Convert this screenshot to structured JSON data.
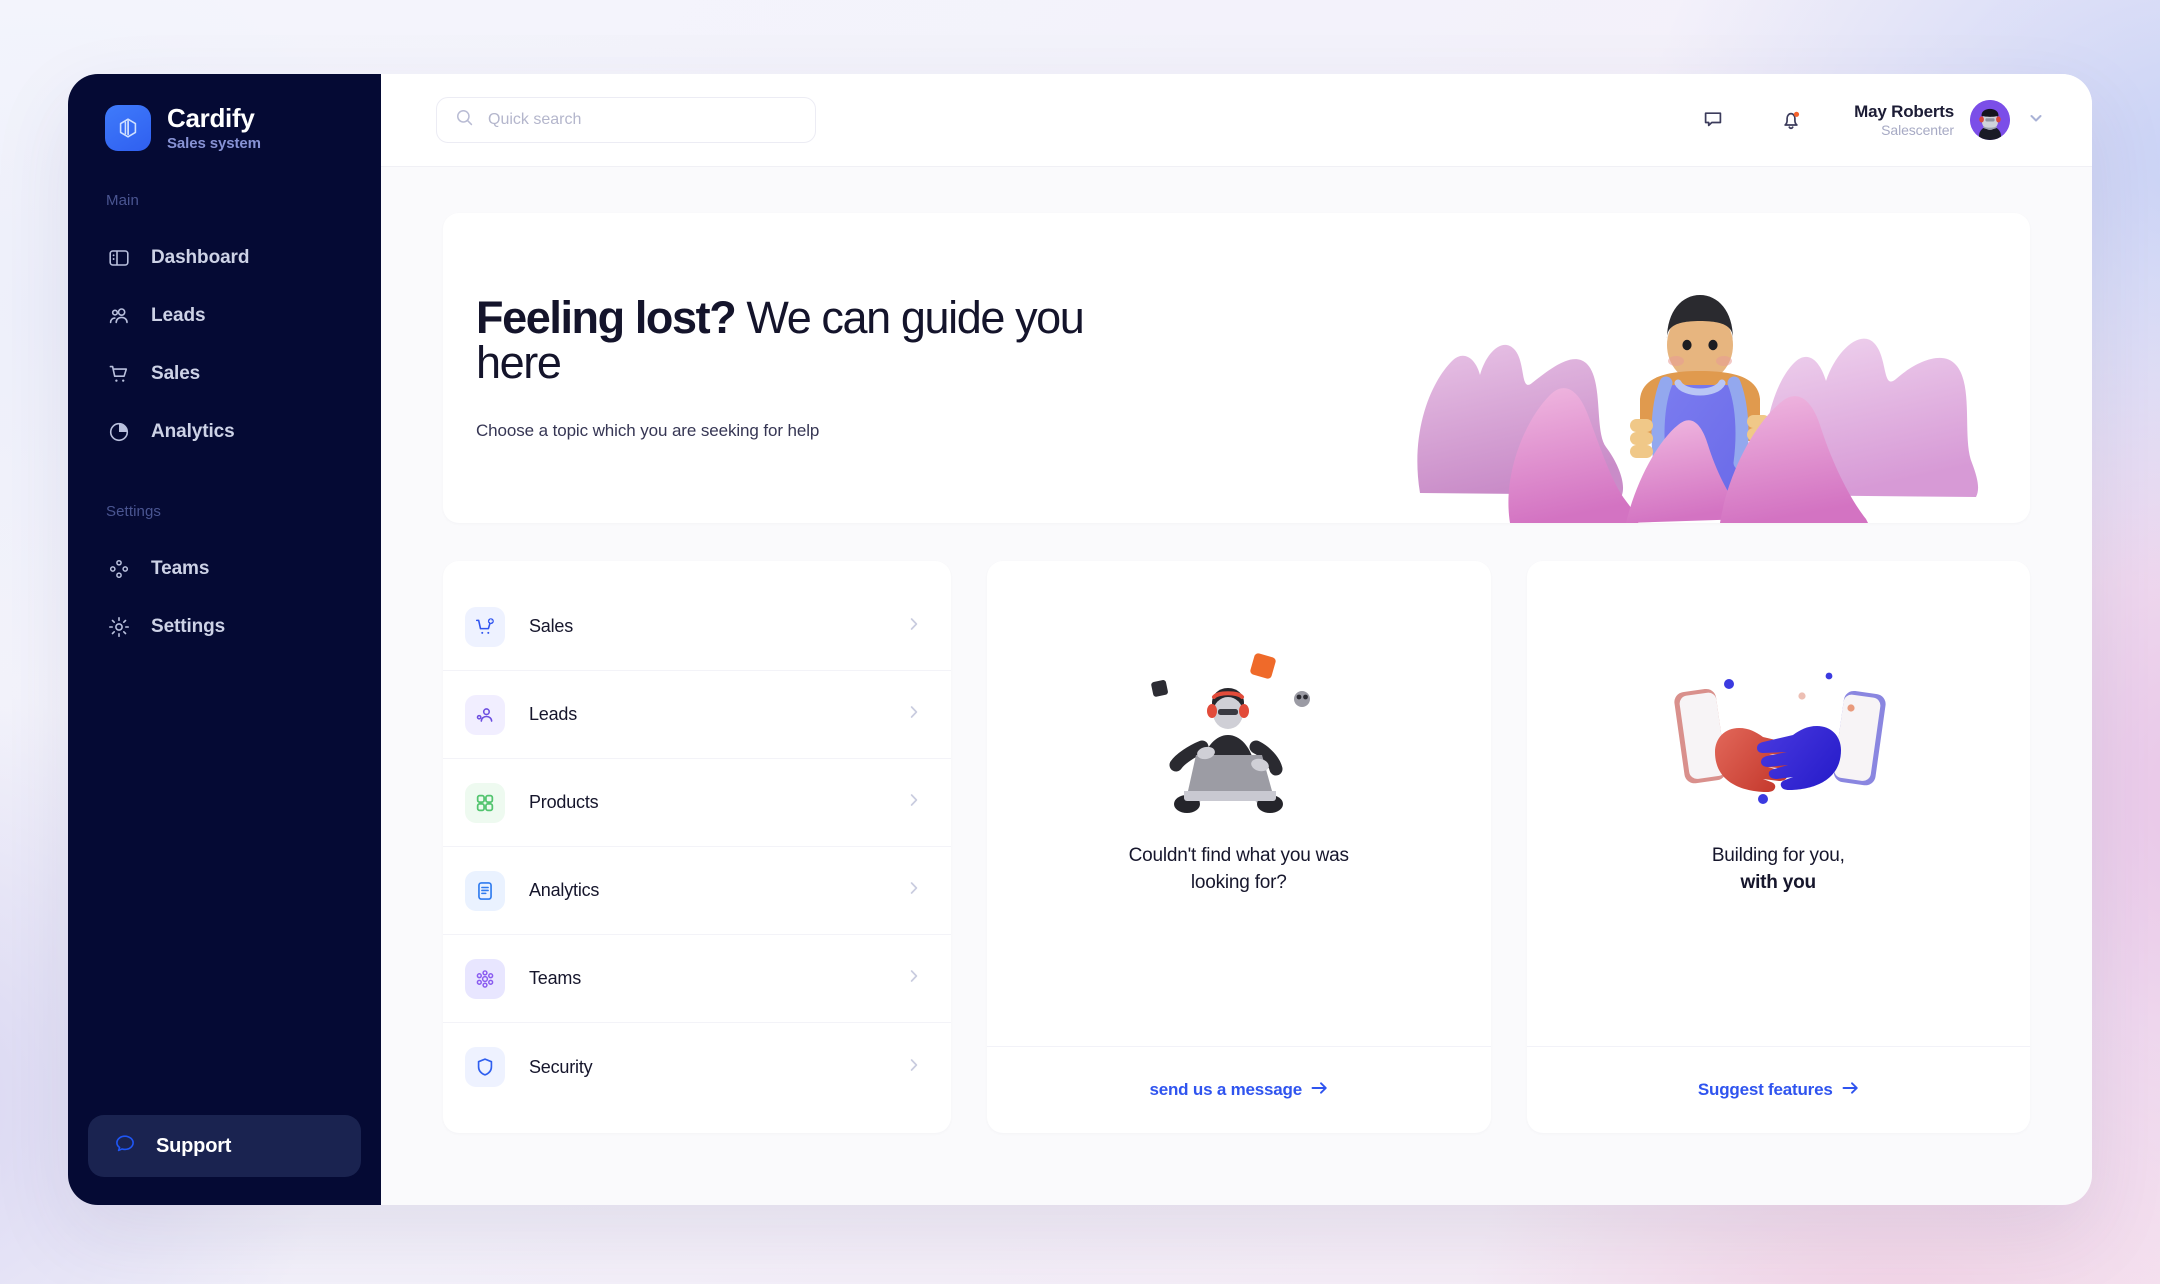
{
  "brand": {
    "name": "Cardify",
    "subtitle": "Sales system",
    "logo_icon": "layers-icon"
  },
  "sidebar": {
    "sections": [
      {
        "label": "Main",
        "items": [
          {
            "label": "Dashboard",
            "icon": "dashboard-icon"
          },
          {
            "label": "Leads",
            "icon": "users-icon"
          },
          {
            "label": "Sales",
            "icon": "cart-icon"
          },
          {
            "label": "Analytics",
            "icon": "pie-chart-icon"
          }
        ]
      },
      {
        "label": "Settings",
        "items": [
          {
            "label": "Teams",
            "icon": "molecule-icon"
          },
          {
            "label": "Settings",
            "icon": "gear-icon"
          }
        ]
      }
    ],
    "support": {
      "label": "Support",
      "icon": "chat-bubble-icon"
    }
  },
  "header": {
    "search": {
      "placeholder": "Quick search",
      "value": "",
      "icon": "search-icon"
    },
    "messages_icon": "chat-bubble-icon",
    "notifications_icon": "bell-icon",
    "notification_badge_color": "#f4622c",
    "user": {
      "name": "May Roberts",
      "role": "Salescenter",
      "avatar": "user-avatar",
      "chevron": "chevron-down-icon"
    }
  },
  "hero": {
    "title_bold": "Feeling lost?",
    "title_rest": " We can guide you here",
    "subtitle": "Choose a topic which you are seeking for help",
    "illustration": "hiker-in-mountains-illustration"
  },
  "topics": {
    "items": [
      {
        "label": "Sales",
        "icon": "cart-plus-icon",
        "icon_color": "#2f54ef",
        "icon_bg": "#eef2ff"
      },
      {
        "label": "Leads",
        "icon": "user-gear-icon",
        "icon_color": "#6d4ee0",
        "icon_bg": "#f1eeff"
      },
      {
        "label": "Products",
        "icon": "grid-icon",
        "icon_color": "#52c46e",
        "icon_bg": "#eefaf0"
      },
      {
        "label": "Analytics",
        "icon": "document-icon",
        "icon_color": "#2f7bef",
        "icon_bg": "#eaf2ff"
      },
      {
        "label": "Teams",
        "icon": "molecule-icon",
        "icon_color": "#8a5cf0",
        "icon_bg": "#e8e6ff"
      },
      {
        "label": "Security",
        "icon": "shield-icon",
        "icon_color": "#2f5fef",
        "icon_bg": "#eef2ff"
      }
    ],
    "chevron_icon": "chevron-right-icon"
  },
  "promos": [
    {
      "title_line1": "Couldn't find what you was",
      "title_line2": "looking for?",
      "title_line2_bold": false,
      "link": "send us a message",
      "link_arrow": "arrow-right-icon",
      "illustration": "person-with-laptop-illustration"
    },
    {
      "title_line1": "Building for you,",
      "title_line2": "with you",
      "title_line2_bold": true,
      "link": "Suggest features",
      "link_arrow": "arrow-right-icon",
      "illustration": "handshake-through-phones-illustration"
    }
  ],
  "colors": {
    "accent": "#2f54ef",
    "sidebar_bg": "#050a34",
    "support_bg": "#1a2350",
    "page_bg": "#fafafc"
  }
}
